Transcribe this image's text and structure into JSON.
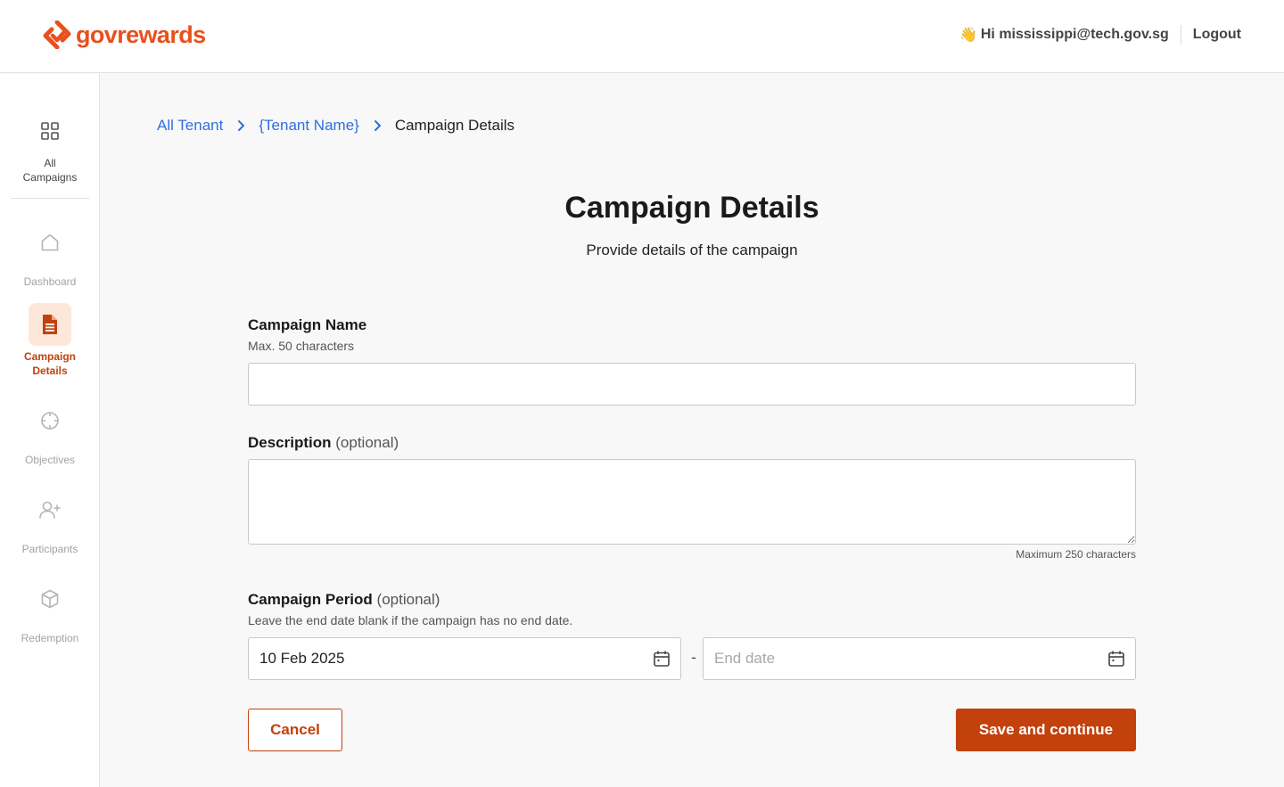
{
  "header": {
    "logo_text": "govrewards",
    "greeting": "Hi mississippi@tech.gov.sg",
    "wave_emoji": "👋",
    "logout_label": "Logout"
  },
  "sidebar": {
    "items": [
      {
        "label": "All\nCampaigns",
        "icon": "grid-icon",
        "state": "normal"
      },
      {
        "label": "Dashboard",
        "icon": "home-icon",
        "state": "disabled"
      },
      {
        "label": "Campaign\nDetails",
        "icon": "document-icon",
        "state": "active"
      },
      {
        "label": "Objectives",
        "icon": "crosshair-icon",
        "state": "disabled"
      },
      {
        "label": "Participants",
        "icon": "user-plus-icon",
        "state": "disabled"
      },
      {
        "label": "Redemption",
        "icon": "box-icon",
        "state": "disabled"
      }
    ]
  },
  "breadcrumb": {
    "items": [
      "All Tenant",
      "{Tenant Name}"
    ],
    "current": "Campaign Details"
  },
  "page": {
    "title": "Campaign Details",
    "subtitle": "Provide details of the campaign"
  },
  "form": {
    "name_label": "Campaign Name",
    "name_hint": "Max. 50 characters",
    "name_value": "",
    "description_label": "Description",
    "optional_text": "(optional)",
    "description_value": "",
    "description_counter": "Maximum 250 characters",
    "period_label": "Campaign Period",
    "period_hint": "Leave the end date blank if the campaign has no end date.",
    "start_date": "10 Feb 2025",
    "end_date_placeholder": "End date",
    "separator": "-"
  },
  "actions": {
    "cancel_label": "Cancel",
    "save_label": "Save and continue"
  },
  "colors": {
    "brand": "#e8501d",
    "primary": "#c2410c",
    "link": "#2f6fde",
    "active_bg": "#fde7da"
  }
}
